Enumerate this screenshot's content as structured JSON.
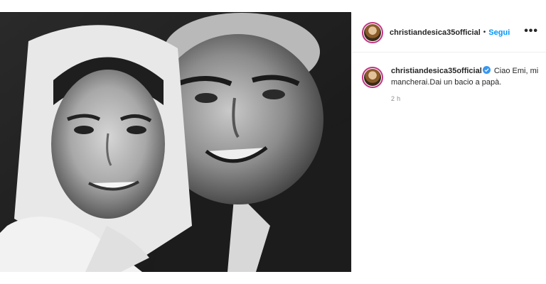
{
  "post": {
    "username": "christiandesica35official",
    "follow_label": "Segui",
    "separator": "•",
    "more_label": "•••",
    "caption": {
      "username": "christiandesica35official",
      "text": "Ciao Emi, mi mancherai.Dai un bacio a papà.",
      "time": "2 h"
    }
  },
  "colors": {
    "follow_blue": "#0095f6",
    "verified_blue": "#3897f0",
    "story_ring": "#c13584"
  }
}
